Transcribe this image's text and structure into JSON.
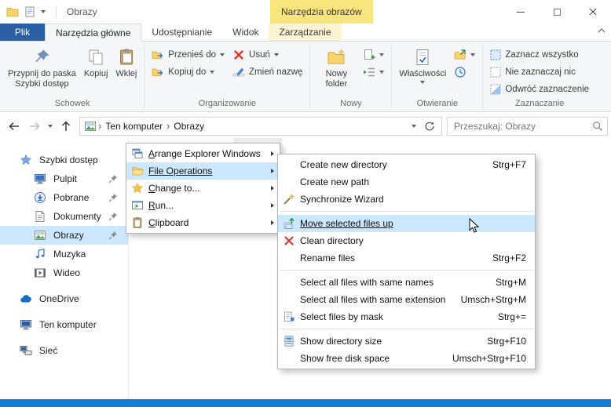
{
  "colors": {
    "file_tab_blue": "#2b5fa3",
    "badge_yellow": "#f9e57e",
    "menu_highlight": "#cce8ff",
    "window_edge_blue": "#127cd6"
  },
  "titlebar": {
    "title": "Obrazy",
    "contextual_badge": "Narzędzia obrazów"
  },
  "tabs": {
    "file": "Plik",
    "home": "Narzędzia główne",
    "share": "Udostępnianie",
    "view": "Widok",
    "manage": "Zarządzanie"
  },
  "ribbon": {
    "clipboard": {
      "label": "Schowek",
      "pin_line1": "Przypnij do paska",
      "pin_line2": "Szybki dostęp",
      "copy": "Kopiuj",
      "paste": "Wklej"
    },
    "organize": {
      "label": "Organizowanie",
      "move_to": "Przenieś do",
      "copy_to": "Kopiuj do",
      "delete": "Usuń",
      "rename": "Zmień nazwę"
    },
    "new": {
      "label": "Nowy",
      "new_folder": "Nowy folder"
    },
    "open": {
      "label": "Otwieranie",
      "properties": "Właściwości"
    },
    "select": {
      "label": "Zaznaczanie",
      "select_all": "Zaznacz wszystko",
      "select_none": "Nie zaznaczaj nic",
      "invert": "Odwróć zaznaczenie"
    }
  },
  "addressbar": {
    "crumb_root": "Ten komputer",
    "crumb_current": "Obrazy",
    "search_placeholder": "Przeszukaj: Obrazy"
  },
  "sidebar": {
    "items": [
      {
        "label": "Szybki dostęp",
        "icon": "quick-access-star"
      },
      {
        "label": "Pulpit",
        "icon": "desktop",
        "pinned": true
      },
      {
        "label": "Pobrane",
        "icon": "downloads",
        "pinned": true
      },
      {
        "label": "Dokumenty",
        "icon": "documents",
        "pinned": true
      },
      {
        "label": "Obrazy",
        "icon": "pictures",
        "pinned": true,
        "selected": true
      },
      {
        "label": "Muzyka",
        "icon": "music"
      },
      {
        "label": "Wideo",
        "icon": "videos"
      },
      {
        "label": "OneDrive",
        "icon": "onedrive"
      },
      {
        "label": "Ten komputer",
        "icon": "this-pc"
      },
      {
        "label": "Sieć",
        "icon": "network"
      }
    ]
  },
  "context_menu": {
    "items": [
      {
        "label": "Arrange Explorer Windows",
        "icon": "cascade-windows",
        "has_submenu": true
      },
      {
        "label": "File Operations",
        "icon": "open-folder",
        "has_submenu": true,
        "highlighted": true
      },
      {
        "label": "Change to...",
        "icon": "yellow-star",
        "has_submenu": true
      },
      {
        "label": "Run...",
        "icon": "run-window",
        "has_submenu": true
      },
      {
        "label": "Clipboard",
        "icon": "clipboard",
        "has_submenu": true
      }
    ]
  },
  "submenu": {
    "items": [
      {
        "label": "Create new directory",
        "shortcut": "Strg+F7"
      },
      {
        "label": "Create new path"
      },
      {
        "label": "Synchronize Wizard",
        "icon": "wizard-wand"
      },
      {
        "separator": true
      },
      {
        "label": "Move selected files up",
        "icon": "move-files-up",
        "highlighted": true
      },
      {
        "label": "Clean directory",
        "icon": "red-x"
      },
      {
        "label": "Rename files",
        "shortcut": "Strg+F2"
      },
      {
        "separator": true
      },
      {
        "label": "Select all files with same names",
        "shortcut": "Strg+M"
      },
      {
        "label": "Select all files with same extension",
        "shortcut": "Umsch+Strg+M"
      },
      {
        "label": "Select files by mask",
        "icon": "file-mask",
        "shortcut": "Strg+="
      },
      {
        "separator": true
      },
      {
        "label": "Show directory size",
        "icon": "directory-size",
        "shortcut": "Strg+F10"
      },
      {
        "label": "Show free disk space",
        "shortcut": "Umsch+Strg+F10"
      }
    ]
  }
}
